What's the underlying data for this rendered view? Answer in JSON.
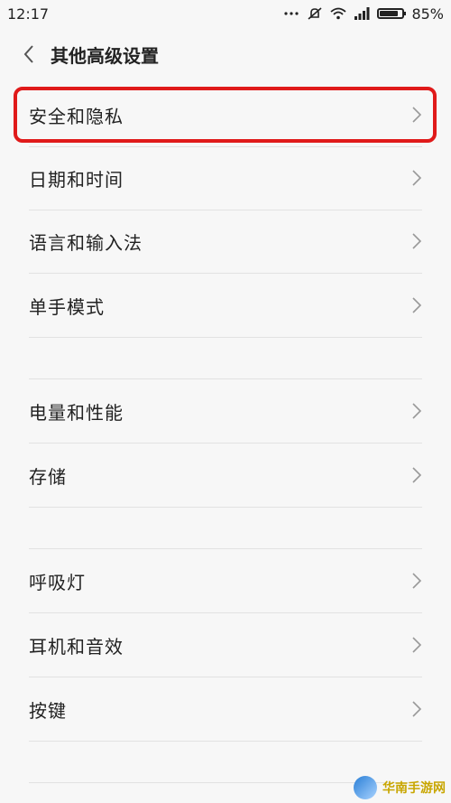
{
  "status": {
    "time": "12:17",
    "battery": "85%",
    "battery_level": 0.85,
    "icons": [
      "more-icon",
      "mute-icon",
      "wifi-icon",
      "signal-icon",
      "battery-icon"
    ]
  },
  "header": {
    "title": "其他高级设置"
  },
  "groups": [
    [
      "安全和隐私",
      "日期和时间",
      "语言和输入法",
      "单手模式"
    ],
    [
      "电量和性能",
      "存储"
    ],
    [
      "呼吸灯",
      "耳机和音效",
      "按键"
    ]
  ],
  "watermark": "华南手游网"
}
